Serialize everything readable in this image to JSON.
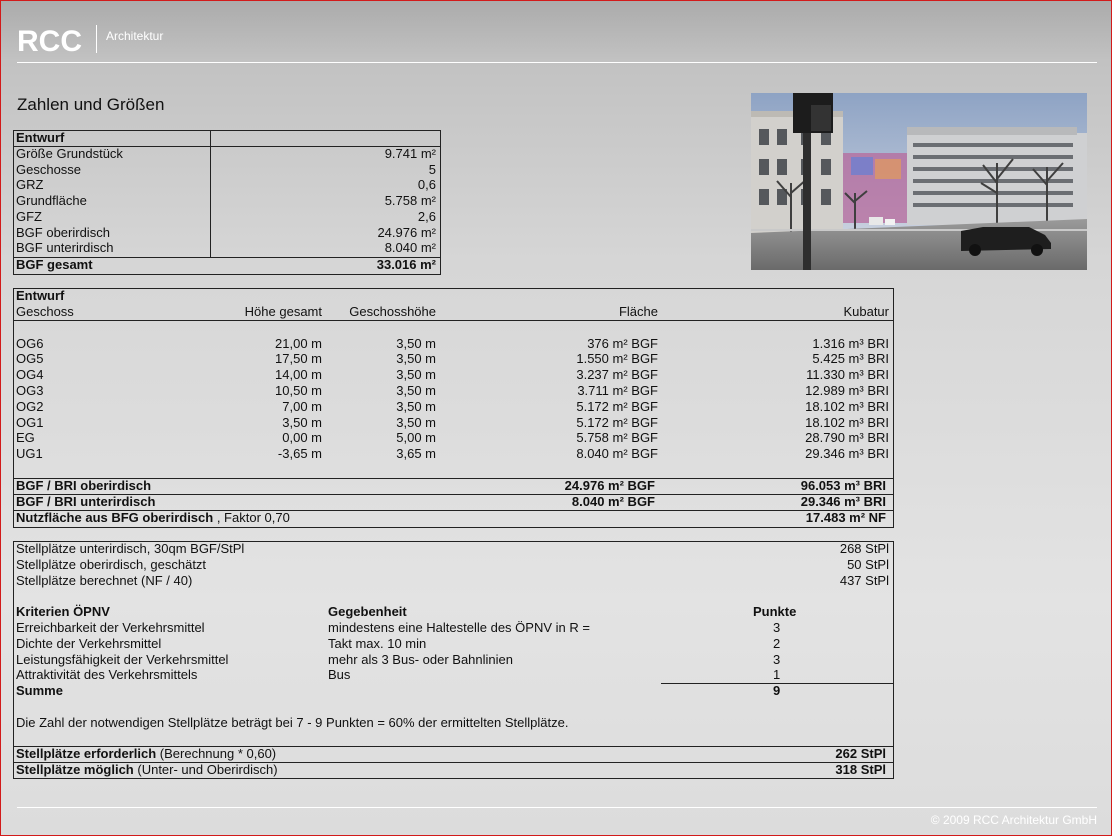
{
  "header": {
    "logo": "RCC",
    "subtitle": "Architektur"
  },
  "footer": {
    "copyright": "© 2009 RCC Architektur GmbH"
  },
  "heading": "Zahlen und Größen",
  "table1": {
    "title": "Entwurf",
    "rows": [
      {
        "label": "Größe Grundstück",
        "value": "9.741 m²"
      },
      {
        "label": "Geschosse",
        "value": "5"
      },
      {
        "label": "GRZ",
        "value": "0,6"
      },
      {
        "label": "Grundfläche",
        "value": "5.758 m²"
      },
      {
        "label": "GFZ",
        "value": "2,6"
      },
      {
        "label": "BGF oberirdisch",
        "value": "24.976 m²"
      },
      {
        "label": "BGF unterirdisch",
        "value": "8.040 m²"
      }
    ],
    "total": {
      "label": "BGF gesamt",
      "value": "33.016 m²"
    }
  },
  "table2": {
    "title": "Entwurf",
    "headers": {
      "geschoss": "Geschoss",
      "hoehe": "Höhe gesamt",
      "geschosshoehe": "Geschosshöhe",
      "flaeche": "Fläche",
      "kubatur": "Kubatur"
    },
    "rows": [
      {
        "geschoss": "OG6",
        "hoehe": "21,00 m",
        "gh": "3,50 m",
        "flaeche": "376 m² BGF",
        "kubatur": "1.316 m³ BRI"
      },
      {
        "geschoss": "OG5",
        "hoehe": "17,50 m",
        "gh": "3,50 m",
        "flaeche": "1.550 m² BGF",
        "kubatur": "5.425 m³ BRI"
      },
      {
        "geschoss": "OG4",
        "hoehe": "14,00 m",
        "gh": "3,50 m",
        "flaeche": "3.237 m² BGF",
        "kubatur": "11.330 m³ BRI"
      },
      {
        "geschoss": "OG3",
        "hoehe": "10,50 m",
        "gh": "3,50 m",
        "flaeche": "3.711 m² BGF",
        "kubatur": "12.989 m³ BRI"
      },
      {
        "geschoss": "OG2",
        "hoehe": "7,00 m",
        "gh": "3,50 m",
        "flaeche": "5.172 m² BGF",
        "kubatur": "18.102 m³ BRI"
      },
      {
        "geschoss": "OG1",
        "hoehe": "3,50 m",
        "gh": "3,50 m",
        "flaeche": "5.172 m² BGF",
        "kubatur": "18.102 m³ BRI"
      },
      {
        "geschoss": "EG",
        "hoehe": "0,00 m",
        "gh": "5,00 m",
        "flaeche": "5.758 m² BGF",
        "kubatur": "28.790 m³ BRI"
      },
      {
        "geschoss": "UG1",
        "hoehe": "-3,65 m",
        "gh": "3,65 m",
        "flaeche": "8.040 m² BGF",
        "kubatur": "29.346 m³ BRI"
      }
    ],
    "sum1": {
      "label": "BGF / BRI oberirdisch",
      "flaeche": "24.976 m² BGF",
      "kubatur": "96.053 m³ BRI"
    },
    "sum2": {
      "label": "BGF / BRI unterirdisch",
      "flaeche": "8.040 m² BGF",
      "kubatur": "29.346 m³ BRI"
    },
    "sum3": {
      "label": "Nutzfläche aus BFG oberirdisch",
      "note": ", Faktor 0,70",
      "value": "17.483 m² NF"
    }
  },
  "table3": {
    "parking": [
      {
        "label": "Stellplätze unterirdisch, 30qm BGF/StPl",
        "value": "268 StPl"
      },
      {
        "label": "Stellplätze oberirdisch, geschätzt",
        "value": "50 StPl"
      },
      {
        "label": "Stellplätze berechnet (NF / 40)",
        "value": "437 StPl"
      }
    ],
    "headers": {
      "kriterien": "Kriterien ÖPNV",
      "gegebenheit": "Gegebenheit",
      "punkte": "Punkte"
    },
    "criteria": [
      {
        "k": "Erreichbarkeit der Verkehrsmittel",
        "g": "mindestens eine Haltestelle des ÖPNV in R =",
        "p": "3"
      },
      {
        "k": "Dichte der Verkehrsmittel",
        "g": "Takt max. 10 min",
        "p": "2"
      },
      {
        "k": "Leistungsfähigkeit der Verkehrsmittel",
        "g": "mehr als 3 Bus- oder Bahnlinien",
        "p": "3"
      },
      {
        "k": "Attraktivität des Verkehrsmittels",
        "g": "Bus",
        "p": "1"
      }
    ],
    "summe": {
      "label": "Summe",
      "value": "9"
    },
    "note": "Die Zahl der notwendigen Stellplätze beträgt bei 7 - 9 Punkten = 60% der ermittelten Stellplätze.",
    "required": {
      "label": "Stellplätze erforderlich",
      "note": "(Berechnung * 0,60)",
      "value": "262 StPl"
    },
    "possible": {
      "label": "Stellplätze möglich",
      "note": "(Unter- und Oberirdisch)",
      "value": "318 StPl"
    }
  }
}
